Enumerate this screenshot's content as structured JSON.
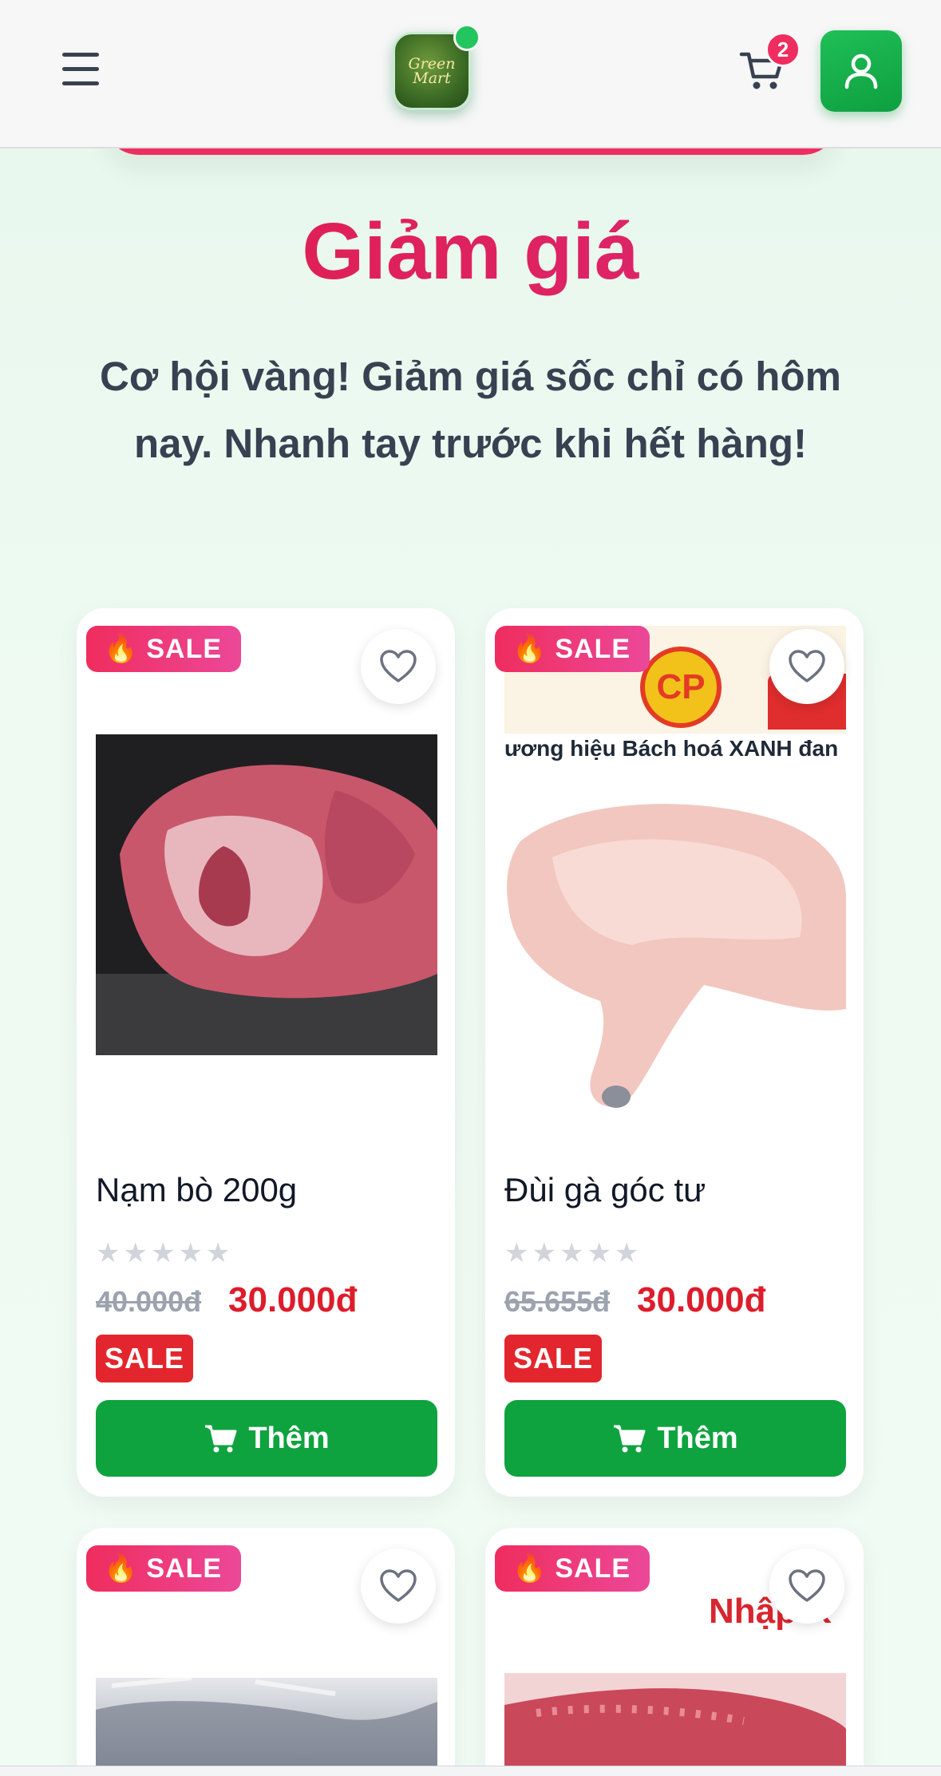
{
  "header": {
    "logo_text_line1": "Green",
    "logo_text_line2": "Mart",
    "cart_count": "2",
    "icons": [
      "menu-icon",
      "cart-icon",
      "user-icon"
    ]
  },
  "hero": {
    "title": "Giảm giá",
    "subtitle": "Cơ hội vàng! Giảm giá sốc chỉ có hôm nay. Nhanh tay trước khi hết hàng!"
  },
  "products": [
    {
      "tag": "SALE",
      "name": "Nạm bò 200g",
      "stars": "★★★★★",
      "old_price": "40.000đ",
      "new_price": "30.000đ",
      "badge": "SALE",
      "button": "Thêm"
    },
    {
      "tag": "SALE",
      "name": "Đùi gà góc tư",
      "stars": "★★★★★",
      "old_price": "65.655đ",
      "new_price": "30.000đ",
      "badge": "SALE",
      "button": "Thêm",
      "image_text": "ương hiệu Bách hoá XANH đan",
      "image_logo": "CP"
    },
    {
      "tag": "SALE"
    },
    {
      "tag": "SALE",
      "image_text": "Nhập K"
    }
  ],
  "colors": {
    "accent_green": "#0ea33f",
    "sale_pink": "#ef2d5e",
    "price_red": "#dc1d2c"
  }
}
